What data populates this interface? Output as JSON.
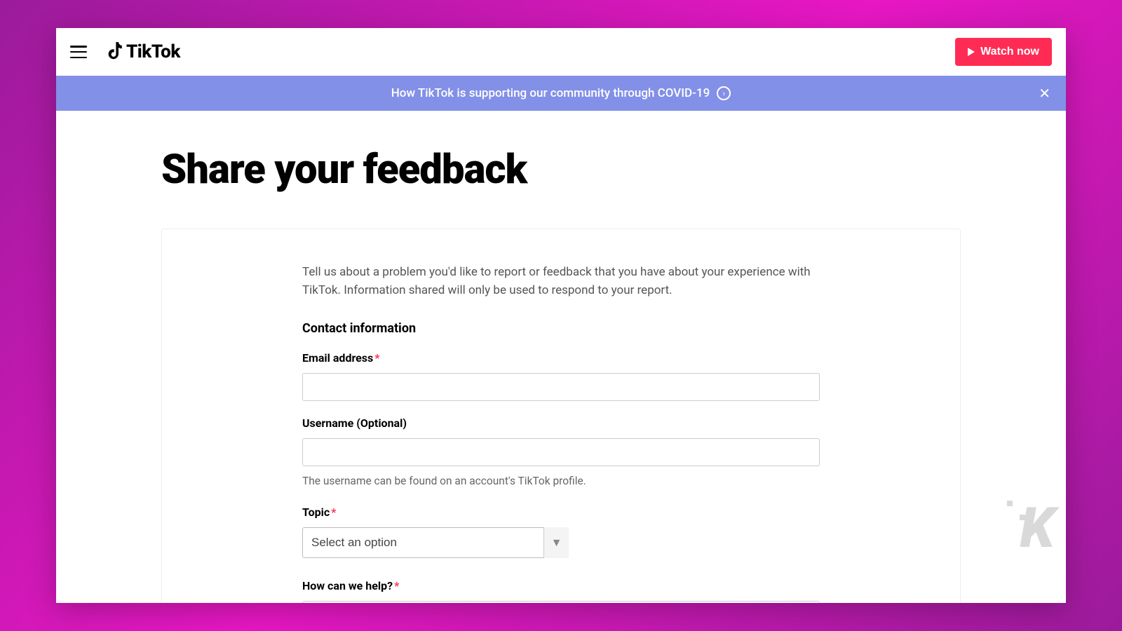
{
  "header": {
    "logo_text": "TikTok",
    "watch_label": "Watch now"
  },
  "banner": {
    "text": "How TikTok is supporting our community through COVID-19"
  },
  "page": {
    "title": "Share your feedback",
    "intro": "Tell us about a problem you'd like to report or feedback that you have about your experience with TikTok. Information shared will only be used to respond to your report.",
    "section_contact": "Contact information",
    "fields": {
      "email_label": "Email address",
      "username_label": "Username (Optional)",
      "username_hint": "The username can be found on an account's TikTok profile.",
      "topic_label": "Topic",
      "topic_placeholder": "Select an option",
      "help_label": "How can we help?"
    }
  },
  "colors": {
    "accent": "#fe2c55",
    "banner_bg": "#8290e8"
  }
}
